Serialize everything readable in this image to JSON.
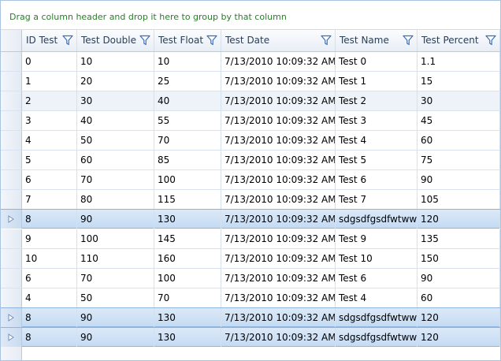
{
  "group_panel": {
    "text": "Drag a column header and drop it here to group by that column"
  },
  "columns": [
    {
      "label": "ID Test"
    },
    {
      "label": "Test Double"
    },
    {
      "label": "Test Float"
    },
    {
      "label": "Test Date"
    },
    {
      "label": "Test Name"
    },
    {
      "label": "Test Percent"
    }
  ],
  "rows": [
    {
      "cells": [
        "0",
        "10",
        "10",
        "7/13/2010 10:09:32 AM",
        "Test 0",
        "1.1"
      ],
      "state": "normal"
    },
    {
      "cells": [
        "1",
        "20",
        "25",
        "7/13/2010 10:09:32 AM",
        "Test 1",
        "15"
      ],
      "state": "normal"
    },
    {
      "cells": [
        "2",
        "30",
        "40",
        "7/13/2010 10:09:32 AM",
        "Test 2",
        "30"
      ],
      "state": "alt"
    },
    {
      "cells": [
        "3",
        "40",
        "55",
        "7/13/2010 10:09:32 AM",
        "Test 3",
        "45"
      ],
      "state": "normal"
    },
    {
      "cells": [
        "4",
        "50",
        "70",
        "7/13/2010 10:09:32 AM",
        "Test 4",
        "60"
      ],
      "state": "normal"
    },
    {
      "cells": [
        "5",
        "60",
        "85",
        "7/13/2010 10:09:32 AM",
        "Test 5",
        "75"
      ],
      "state": "normal"
    },
    {
      "cells": [
        "6",
        "70",
        "100",
        "7/13/2010 10:09:32 AM",
        "Test 6",
        "90"
      ],
      "state": "normal"
    },
    {
      "cells": [
        "7",
        "80",
        "115",
        "7/13/2010 10:09:32 AM",
        "Test 7",
        "105"
      ],
      "state": "normal"
    },
    {
      "cells": [
        "8",
        "90",
        "130",
        "7/13/2010 10:09:32 AM",
        "sdgsdfgsdfwtwwf",
        "120"
      ],
      "state": "selected"
    },
    {
      "cells": [
        "9",
        "100",
        "145",
        "7/13/2010 10:09:32 AM",
        "Test 9",
        "135"
      ],
      "state": "normal"
    },
    {
      "cells": [
        "10",
        "110",
        "160",
        "7/13/2010 10:09:32 AM",
        "Test 10",
        "150"
      ],
      "state": "normal"
    },
    {
      "cells": [
        "6",
        "70",
        "100",
        "7/13/2010 10:09:32 AM",
        "Test 6",
        "90"
      ],
      "state": "normal"
    },
    {
      "cells": [
        "4",
        "50",
        "70",
        "7/13/2010 10:09:32 AM",
        "Test 4",
        "60"
      ],
      "state": "normal"
    },
    {
      "cells": [
        "8",
        "90",
        "130",
        "7/13/2010 10:09:32 AM",
        "sdgsdfgsdfwtwwf",
        "120"
      ],
      "state": "selected"
    },
    {
      "cells": [
        "8",
        "90",
        "130",
        "7/13/2010 10:09:32 AM",
        "sdgsdfgsdfwtwwf",
        "120"
      ],
      "state": "selected"
    }
  ],
  "icons": {
    "filter": "filter-funnel-icon",
    "row_indicator": "current-row-arrow-icon"
  },
  "colors": {
    "group_text": "#2a7d2a",
    "selection": "#c4dbf3",
    "filter_icon": "#3a6eb4"
  }
}
